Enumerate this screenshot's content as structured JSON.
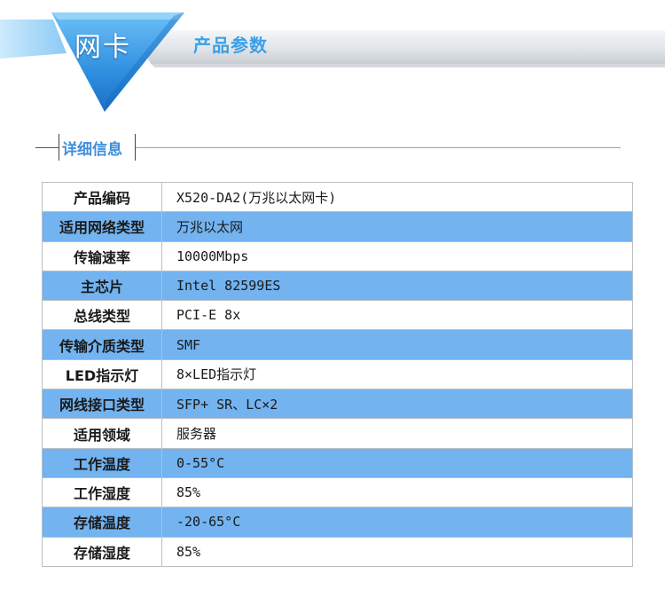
{
  "header": {
    "category": "网卡",
    "subtitle": "产品参数"
  },
  "section": {
    "title": "详细信息"
  },
  "specs": [
    {
      "label": "产品编码",
      "value": "X520-DA2(万兆以太网卡)"
    },
    {
      "label": "适用网络类型",
      "value": "万兆以太网"
    },
    {
      "label": "传输速率",
      "value": "10000Mbps"
    },
    {
      "label": "主芯片",
      "value": "Intel 82599ES"
    },
    {
      "label": "总线类型",
      "value": "PCI-E 8x"
    },
    {
      "label": "传输介质类型",
      "value": "SMF"
    },
    {
      "label": "LED指示灯",
      "value": "8×LED指示灯"
    },
    {
      "label": "网线接口类型",
      "value": "SFP+ SR、LC×2"
    },
    {
      "label": "适用领域",
      "value": "服务器"
    },
    {
      "label": "工作温度",
      "value": "0-55°C"
    },
    {
      "label": "工作湿度",
      "value": "85%"
    },
    {
      "label": "存储温度",
      "value": "-20-65°C"
    },
    {
      "label": "存储湿度",
      "value": "85%"
    }
  ],
  "colors": {
    "accent": "#3aa0e8",
    "row_highlight": "#72b3f0",
    "heading": "#3d8fdc"
  }
}
